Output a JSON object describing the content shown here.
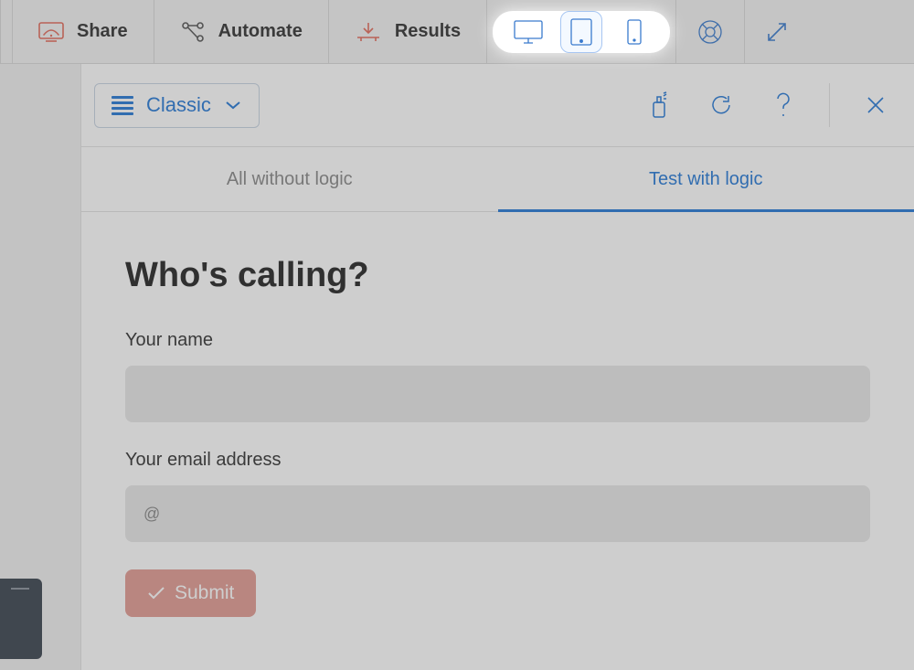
{
  "toolbar": {
    "share_label": "Share",
    "automate_label": "Automate",
    "results_label": "Results"
  },
  "theme": {
    "label": "Classic"
  },
  "tabs": {
    "all_label": "All without logic",
    "test_label": "Test with logic"
  },
  "form": {
    "title": "Who's calling?",
    "name_label": "Your name",
    "email_label": "Your email address",
    "email_placeholder": "@",
    "submit_label": "Submit"
  }
}
